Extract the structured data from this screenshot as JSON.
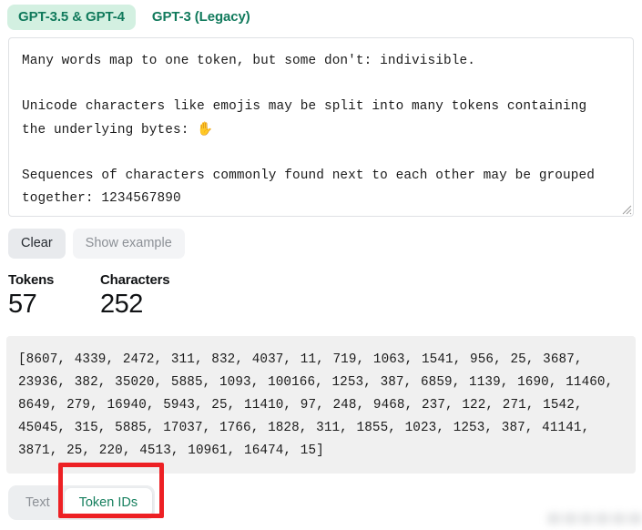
{
  "model_tabs": [
    {
      "label": "GPT-3.5 & GPT-4",
      "active": true
    },
    {
      "label": "GPT-3 (Legacy)",
      "active": false
    }
  ],
  "editor": {
    "value": "Many words map to one token, but some don't: indivisible.\n\nUnicode characters like emojis may be split into many tokens containing the underlying bytes: ✋\n\nSequences of characters commonly found next to each other may be grouped together: 1234567890",
    "line1": "Many words map to one token, but some don't: indivisible.",
    "line2a": "Unicode characters like emojis may be split into many tokens containing",
    "line2b": "the underlying bytes: ",
    "emoji": "✋",
    "emoji_name": "raised-hand-emoji",
    "line3a": "Sequences of characters commonly found next to each other may be grouped",
    "line3b": "together: 1234567890",
    "resize_handle": "resize-grip"
  },
  "actions": {
    "clear_label": "Clear",
    "show_example_label": "Show example"
  },
  "stats": {
    "tokens_label": "Tokens",
    "tokens_value": "57",
    "characters_label": "Characters",
    "characters_value": "252"
  },
  "token_output": {
    "text": "[8607, 4339, 2472, 311, 832, 4037, 11, 719, 1063, 1541, 956, 25, 3687, 23936, 382, 35020, 5885, 1093, 100166, 1253, 387, 6859, 1139, 1690, 11460, 8649, 279, 16940, 5943, 25, 11410, 97, 248, 9468, 237, 122, 271, 1542, 45045, 315, 5885, 17037, 1766, 1828, 311, 1855, 1023, 1253, 387, 41141, 3871, 25, 220, 4513, 10961, 16474, 15]",
    "ids": [
      8607,
      4339,
      2472,
      311,
      832,
      4037,
      11,
      719,
      1063,
      1541,
      956,
      25,
      3687,
      23936,
      382,
      35020,
      5885,
      1093,
      100166,
      1253,
      387,
      6859,
      1139,
      1690,
      11460,
      8649,
      279,
      16940,
      5943,
      25,
      11410,
      97,
      248,
      9468,
      237,
      122,
      271,
      1542,
      45045,
      315,
      5885,
      17037,
      1766,
      1828,
      311,
      1855,
      1023,
      1253,
      387,
      41141,
      3871,
      25,
      220,
      4513,
      10961,
      16474,
      15
    ]
  },
  "view_tabs": [
    {
      "label": "Text",
      "active": false
    },
    {
      "label": "Token IDs",
      "active": true
    }
  ],
  "annotation": {
    "target": "Token IDs",
    "color": "#ed2024"
  },
  "colors": {
    "accent_green": "#17805f",
    "active_tab_bg": "#d3f0e1",
    "token_panel_bg": "#f0f0f0",
    "annotation_red": "#ed2024"
  }
}
